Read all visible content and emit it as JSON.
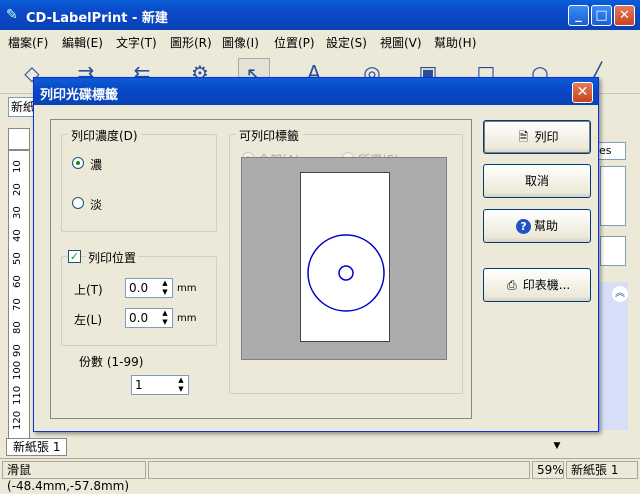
{
  "app": {
    "title": "CD-LabelPrint - 新建",
    "menu": [
      "檔案(F)",
      "編輯(E)",
      "文字(T)",
      "圖形(R)",
      "圖像(I)",
      "位置(P)",
      "設定(S)",
      "視圖(V)",
      "幫助(H)"
    ],
    "addr_value": "新紙張 1",
    "right_combo_value": "es",
    "sheet_tab": "新紙張 1",
    "ruler_numbers": [
      "10",
      "20",
      "30",
      "40",
      "50",
      "60",
      "70",
      "80",
      "90",
      "100",
      "110",
      "120"
    ]
  },
  "statusbar": {
    "mouse": "滑鼠 (-48.4mm,-57.8mm)",
    "zoom": "59%",
    "sheet": "新紙張 1"
  },
  "dialog": {
    "title": "列印光碟標籤",
    "density": {
      "legend": "列印濃度(D)",
      "options": [
        {
          "label": "濃",
          "selected": true
        },
        {
          "label": "淡",
          "selected": false
        }
      ]
    },
    "position": {
      "legend": "列印位置",
      "checked": true,
      "top_label": "上(T)",
      "top_value": "0.0",
      "left_label": "左(L)",
      "left_value": "0.0",
      "unit": "mm"
    },
    "copies": {
      "label": "份數 (1-99)",
      "value": "1"
    },
    "printable": {
      "legend": "可列印標籤",
      "options": [
        {
          "label": "全部(A)",
          "selected": true
        },
        {
          "label": "所選(S)",
          "selected": false
        }
      ]
    },
    "buttons": {
      "print": "列印",
      "cancel": "取消",
      "help": "幫助",
      "printer": "印表機..."
    }
  },
  "colors": {
    "title_blue": "#0a4fd0",
    "disc_blue": "#0000cc"
  }
}
